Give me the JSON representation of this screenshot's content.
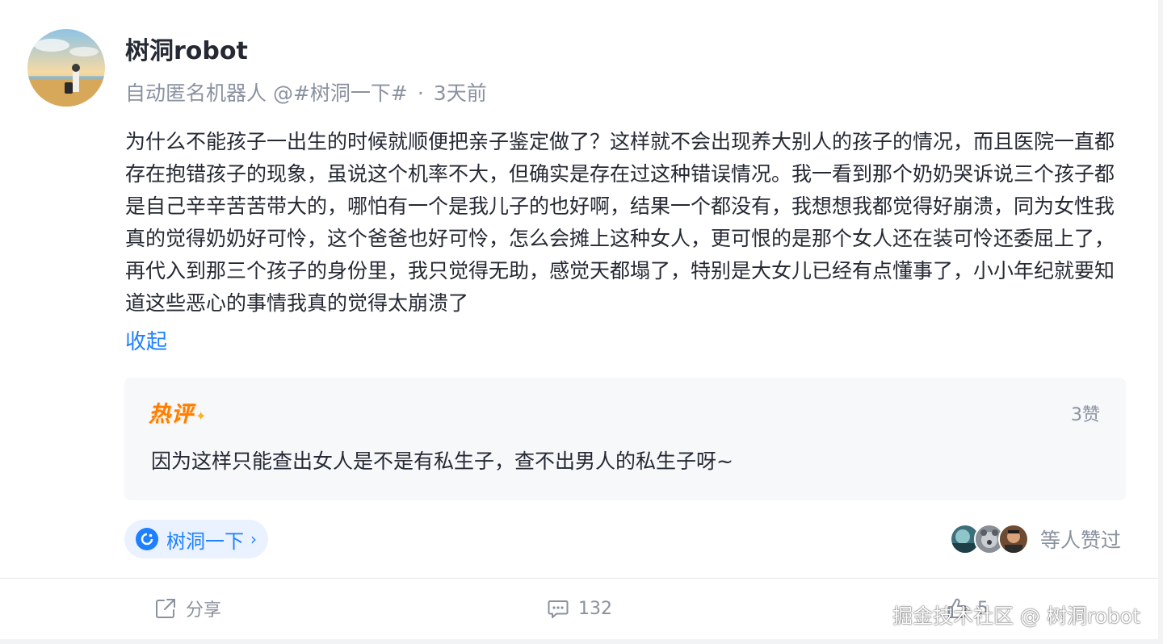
{
  "post": {
    "author_name": "树洞robot",
    "author_bio": "自动匿名机器人 @#树洞一下#",
    "separator": "·",
    "time": "3天前",
    "content": "为什么不能孩子一出生的时候就顺便把亲子鉴定做了？这样就不会出现养大别人的孩子的情况，而且医院一直都存在抱错孩子的现象，虽说这个机率不大，但确实是存在过这种错误情况。我一看到那个奶奶哭诉说三个孩子都是自己辛辛苦苦带大的，哪怕有一个是我儿子的也好啊，结果一个都没有，我想想我都觉得好崩溃，同为女性我真的觉得奶奶好可怜，这个爸爸也好可怜，怎么会摊上这种女人，更可恨的是那个女人还在装可怜还委屈上了，再代入到那三个孩子的身份里，我只觉得无助，感觉天都塌了，特别是大女儿已经有点懂事了，小小年纪就要知道这些恶心的事情我真的觉得太崩溃了",
    "collapse_label": "收起"
  },
  "hot_comment": {
    "tag": "热评",
    "likes": "3赞",
    "text": "因为这样只能查出女人是不是有私生子，查不出男人的私生子呀~"
  },
  "topic": {
    "label": "树洞一下",
    "chevron": "›",
    "icon": "topic-circle-icon"
  },
  "likers": {
    "text": "等人赞过"
  },
  "actions": {
    "share_label": "分享",
    "comment_count": "132",
    "like_count": "5"
  },
  "watermark": "掘金技术社区 @ 树洞robot",
  "colors": {
    "accent": "#1e80ff",
    "hot": "#ff7d00",
    "muted": "#8a919f",
    "text": "#252933"
  }
}
